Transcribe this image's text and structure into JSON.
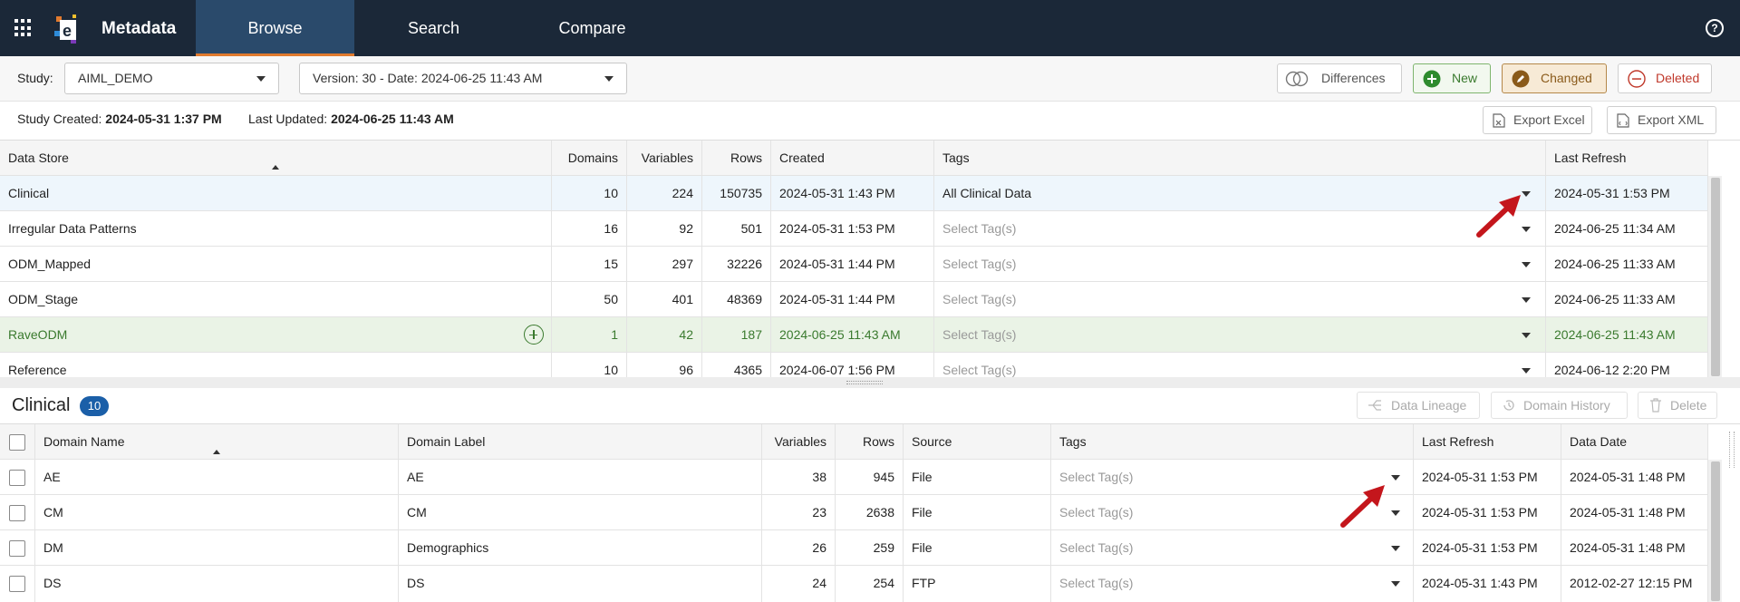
{
  "app": {
    "name": "Metadata",
    "help_label": "?"
  },
  "nav": {
    "tabs": [
      "Browse",
      "Search",
      "Compare"
    ],
    "active": "Browse"
  },
  "toolbar": {
    "study_label": "Study:",
    "study_value": "AIML_DEMO",
    "version_value": "Version: 30 - Date: 2024-06-25 11:43 AM",
    "differences_label": "Differences",
    "new_label": "New",
    "changed_label": "Changed",
    "deleted_label": "Deleted"
  },
  "info": {
    "created_label": "Study Created:",
    "created_value": "2024-05-31 1:37 PM",
    "updated_label": "Last Updated:",
    "updated_value": "2024-06-25 11:43 AM",
    "export_excel": "Export Excel",
    "export_xml": "Export XML"
  },
  "datastores": {
    "columns": [
      "Data Store",
      "Domains",
      "Variables",
      "Rows",
      "Created",
      "Tags",
      "Last Refresh"
    ],
    "rows": [
      {
        "name": "Clinical",
        "domains": "10",
        "variables": "224",
        "rows": "150735",
        "created": "2024-05-31 1:43 PM",
        "tags": "All Clinical Data",
        "last_refresh": "2024-05-31 1:53 PM"
      },
      {
        "name": "Irregular Data Patterns",
        "domains": "16",
        "variables": "92",
        "rows": "501",
        "created": "2024-05-31 1:53 PM",
        "tags": "Select Tag(s)",
        "last_refresh": "2024-06-25 11:34 AM"
      },
      {
        "name": "ODM_Mapped",
        "domains": "15",
        "variables": "297",
        "rows": "32226",
        "created": "2024-05-31 1:44 PM",
        "tags": "Select Tag(s)",
        "last_refresh": "2024-06-25 11:33 AM"
      },
      {
        "name": "ODM_Stage",
        "domains": "50",
        "variables": "401",
        "rows": "48369",
        "created": "2024-05-31 1:44 PM",
        "tags": "Select Tag(s)",
        "last_refresh": "2024-06-25 11:33 AM"
      },
      {
        "name": "RaveODM",
        "domains": "1",
        "variables": "42",
        "rows": "187",
        "created": "2024-06-25 11:43 AM",
        "tags": "Select Tag(s)",
        "last_refresh": "2024-06-25 11:43 AM"
      },
      {
        "name": "Reference",
        "domains": "10",
        "variables": "96",
        "rows": "4365",
        "created": "2024-06-07 1:56 PM",
        "tags": "Select Tag(s)",
        "last_refresh": "2024-06-12 2:20 PM"
      }
    ]
  },
  "domains_section": {
    "title": "Clinical",
    "count": "10",
    "data_lineage": "Data Lineage",
    "domain_history": "Domain History",
    "delete": "Delete",
    "columns": [
      "Domain Name",
      "Domain Label",
      "Variables",
      "Rows",
      "Source",
      "Tags",
      "Last Refresh",
      "Data Date"
    ],
    "rows": [
      {
        "name": "AE",
        "label": "AE",
        "variables": "38",
        "rows": "945",
        "source": "File",
        "tags": "Select Tag(s)",
        "last_refresh": "2024-05-31 1:53 PM",
        "data_date": "2024-05-31 1:48 PM"
      },
      {
        "name": "CM",
        "label": "CM",
        "variables": "23",
        "rows": "2638",
        "source": "File",
        "tags": "Select Tag(s)",
        "last_refresh": "2024-05-31 1:53 PM",
        "data_date": "2024-05-31 1:48 PM"
      },
      {
        "name": "DM",
        "label": "Demographics",
        "variables": "26",
        "rows": "259",
        "source": "File",
        "tags": "Select Tag(s)",
        "last_refresh": "2024-05-31 1:53 PM",
        "data_date": "2024-05-31 1:48 PM"
      },
      {
        "name": "DS",
        "label": "DS",
        "variables": "24",
        "rows": "254",
        "source": "FTP",
        "tags": "Select Tag(s)",
        "last_refresh": "2024-05-31 1:43 PM",
        "data_date": "2012-02-27 12:15 PM"
      }
    ]
  },
  "colors": {
    "nav_bg": "#1b2838",
    "active_tab": "#2a4a6b",
    "new_green": "#3a7a2e",
    "changed_orange": "#8a5a1a",
    "deleted_red": "#c0392b",
    "badge_blue": "#1b5fa8",
    "annotation_red": "#c4161c"
  }
}
